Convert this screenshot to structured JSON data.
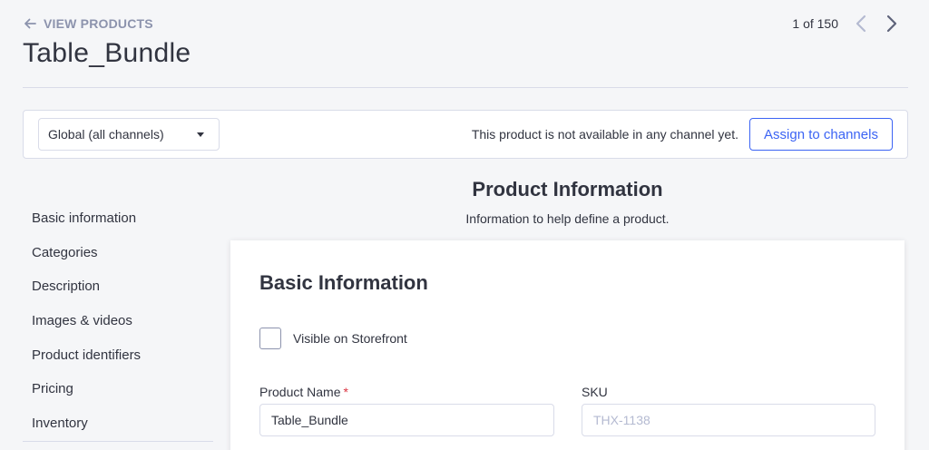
{
  "header": {
    "back_label": "VIEW PRODUCTS",
    "title": "Table_Bundle",
    "pager_text": "1 of 150"
  },
  "channel_bar": {
    "select_value": "Global (all channels)",
    "message": "This product is not available in any channel yet.",
    "assign_label": "Assign to channels"
  },
  "sidebar": {
    "items": [
      {
        "label": "Basic information"
      },
      {
        "label": "Categories"
      },
      {
        "label": "Description"
      },
      {
        "label": "Images & videos"
      },
      {
        "label": "Product identifiers"
      },
      {
        "label": "Pricing"
      },
      {
        "label": "Inventory"
      }
    ]
  },
  "section": {
    "title": "Product Information",
    "subtitle": "Information to help define a product."
  },
  "card": {
    "title": "Basic Information",
    "visible_label": "Visible on Storefront",
    "visible_checked": false,
    "product_name_label": "Product Name",
    "required_marker": "*",
    "product_name_value": "Table_Bundle",
    "sku_label": "SKU",
    "sku_placeholder": "THX-1138"
  },
  "colors": {
    "accent": "#3c64f4",
    "required": "#db3643",
    "muted": "#8c93ad",
    "background": "#f5f6f8"
  }
}
